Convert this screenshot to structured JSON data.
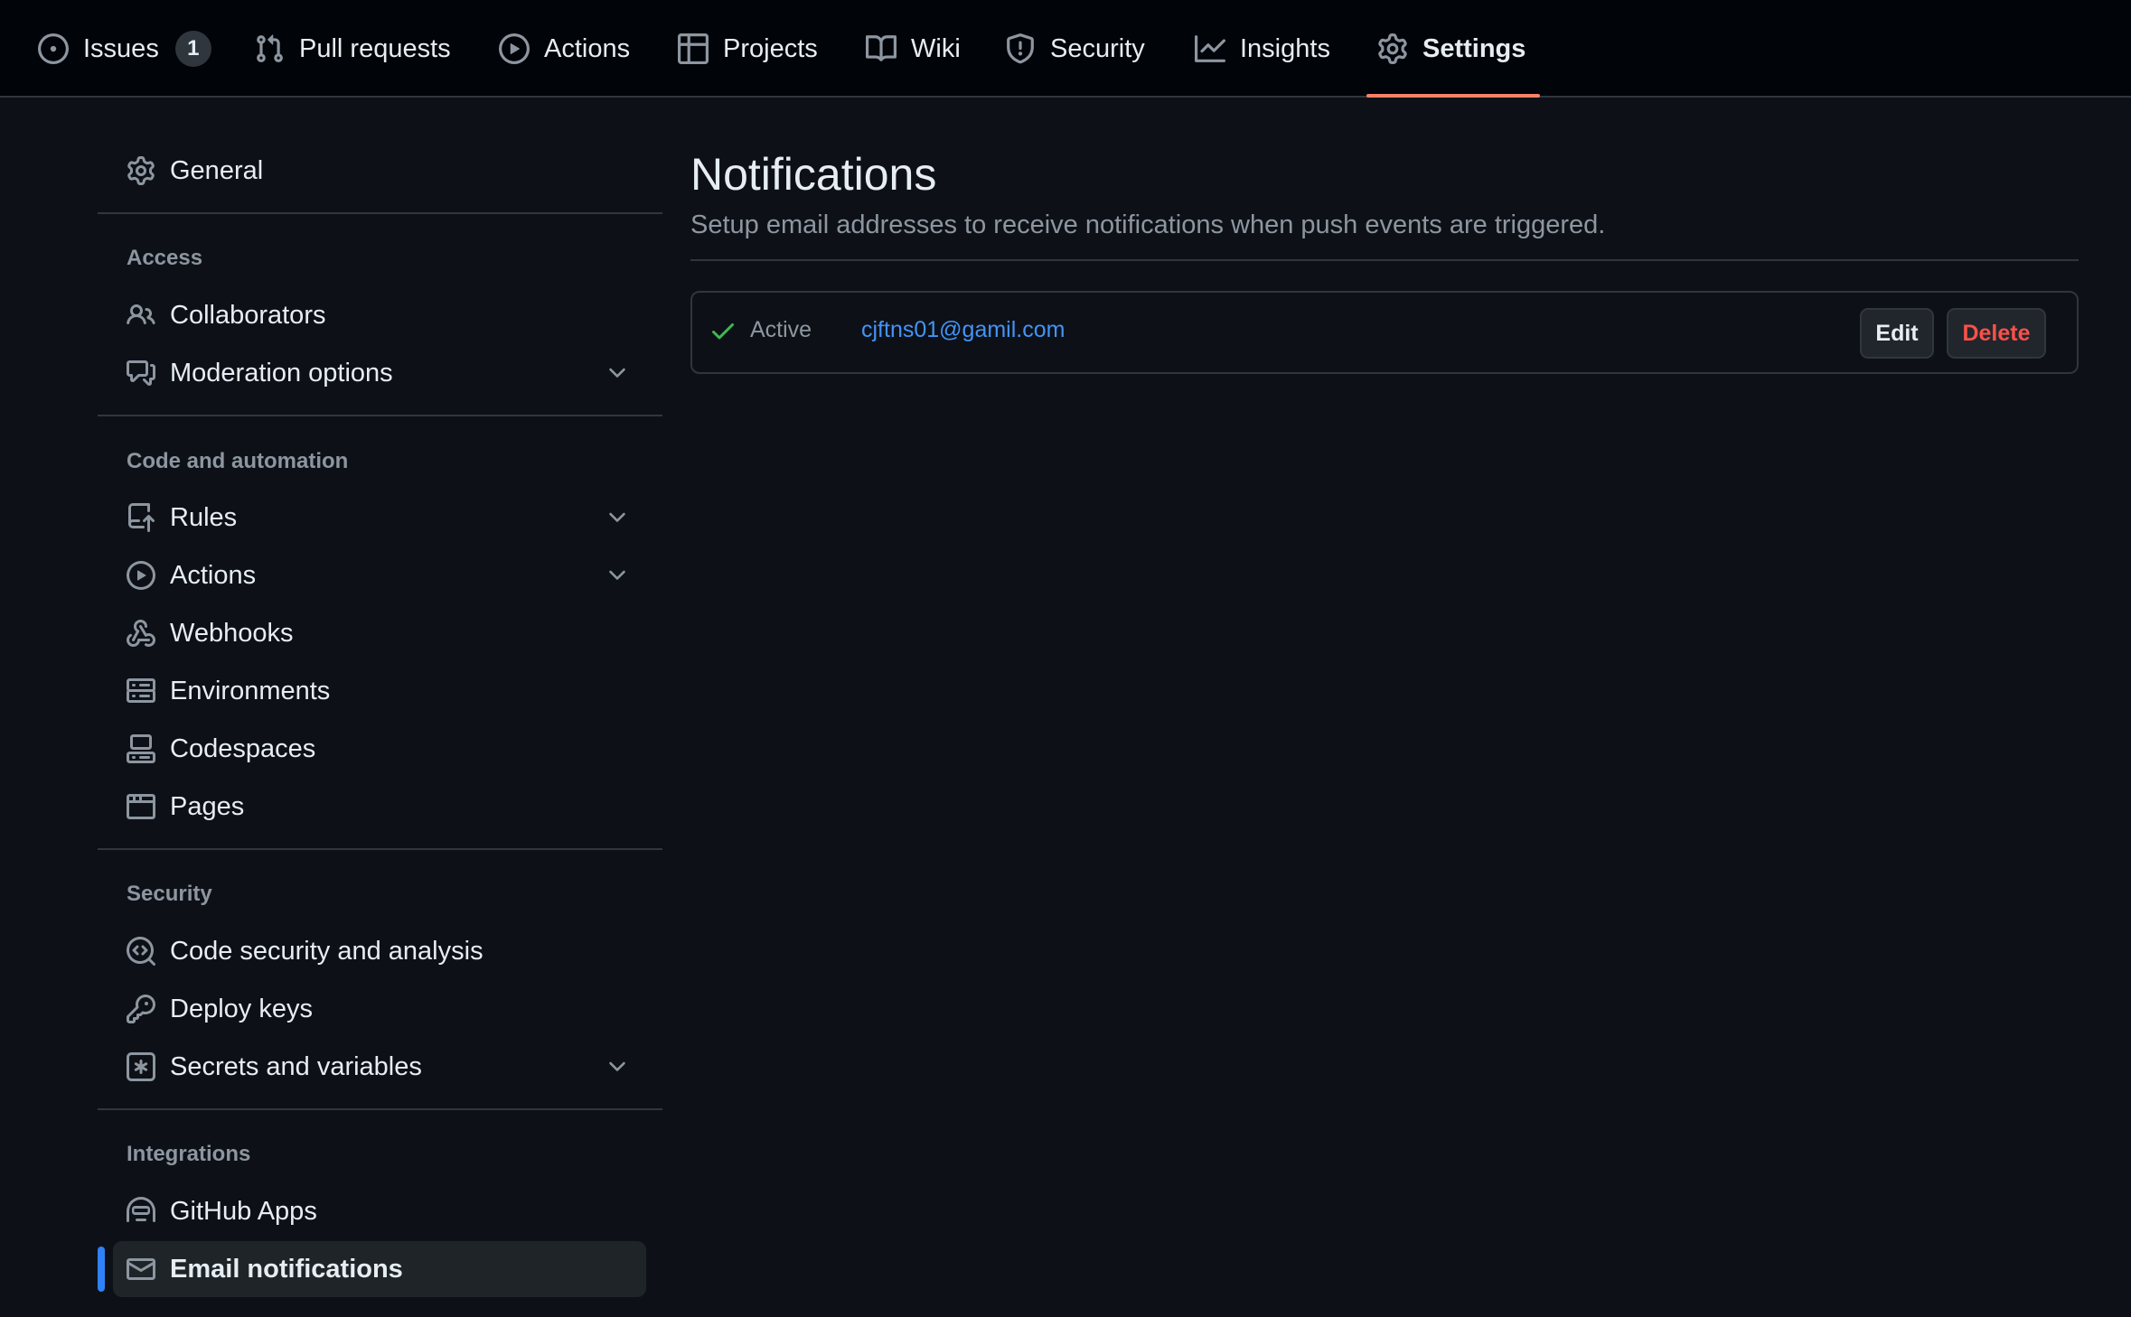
{
  "colors": {
    "background": "#0d1117",
    "topnav_background": "#010409",
    "tab_underline": "#f78166",
    "active_indicator": "#2f81f7",
    "link": "#4493f8",
    "success": "#3fb950",
    "danger": "#f85149"
  },
  "topnav": {
    "tabs": [
      {
        "label": "Issues",
        "icon": "issue-opened-icon",
        "counter": "1"
      },
      {
        "label": "Pull requests",
        "icon": "git-pull-request-icon"
      },
      {
        "label": "Actions",
        "icon": "play-icon"
      },
      {
        "label": "Projects",
        "icon": "table-icon"
      },
      {
        "label": "Wiki",
        "icon": "book-icon"
      },
      {
        "label": "Security",
        "icon": "shield-icon"
      },
      {
        "label": "Insights",
        "icon": "graph-icon"
      },
      {
        "label": "Settings",
        "icon": "gear-icon",
        "selected": true
      }
    ]
  },
  "sidebar": {
    "general": {
      "label": "General",
      "icon": "gear-icon"
    },
    "sections": [
      {
        "heading": "Access",
        "items": [
          {
            "label": "Collaborators",
            "icon": "people-icon"
          },
          {
            "label": "Moderation options",
            "icon": "comment-discussion-icon",
            "expandable": true
          }
        ]
      },
      {
        "heading": "Code and automation",
        "items": [
          {
            "label": "Rules",
            "icon": "repo-push-icon",
            "expandable": true
          },
          {
            "label": "Actions",
            "icon": "play-icon",
            "expandable": true
          },
          {
            "label": "Webhooks",
            "icon": "webhook-icon"
          },
          {
            "label": "Environments",
            "icon": "server-icon"
          },
          {
            "label": "Codespaces",
            "icon": "codespaces-icon"
          },
          {
            "label": "Pages",
            "icon": "browser-icon"
          }
        ]
      },
      {
        "heading": "Security",
        "items": [
          {
            "label": "Code security and analysis",
            "icon": "codescan-icon"
          },
          {
            "label": "Deploy keys",
            "icon": "key-icon"
          },
          {
            "label": "Secrets and variables",
            "icon": "key-asterisk-icon",
            "expandable": true
          }
        ]
      },
      {
        "heading": "Integrations",
        "items": [
          {
            "label": "GitHub Apps",
            "icon": "hubot-icon"
          },
          {
            "label": "Email notifications",
            "icon": "mail-icon",
            "active": true
          }
        ]
      }
    ]
  },
  "main": {
    "title": "Notifications",
    "subtitle": "Setup email addresses to receive notifications when push events are triggered.",
    "hook": {
      "status": "Active",
      "status_icon": "check-icon",
      "email": "cjftns01@gamil.com",
      "edit_label": "Edit",
      "delete_label": "Delete"
    }
  }
}
